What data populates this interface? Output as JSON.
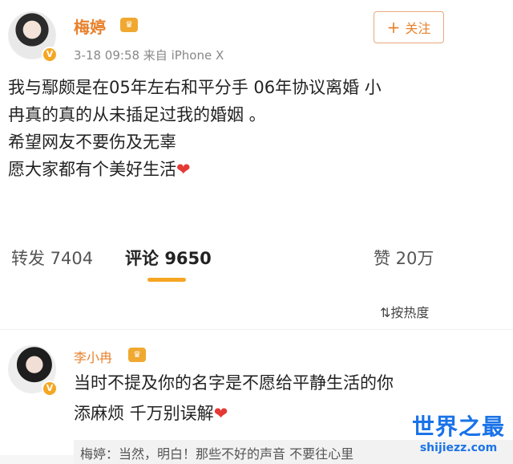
{
  "post": {
    "username": "梅婷",
    "meta": "3-18 09:58 来自 iPhone X",
    "follow_label": "关注",
    "lines": [
      "我与鄢颇是在05年左右和平分手  06年协议离婚 小",
      "冉真的真的从未插足过我的婚姻 。",
      "希望网友不要伤及无辜",
      "愿大家都有个美好生活"
    ]
  },
  "stats": {
    "repost": "转发 7404",
    "comment_label": "评论",
    "comment_count": "9650",
    "like": "赞 20万"
  },
  "sort_label": "按热度",
  "comment": {
    "username": "李小冉",
    "lines": [
      "当时不提及你的名字是不愿给平静生活的你",
      "添麻烦 千万别误解"
    ],
    "reply_preview": "梅婷：当然，明白！那些不好的声音 不要往心里"
  },
  "watermark": {
    "main": "世界之最",
    "sub": "shijiezz.com"
  },
  "colors": {
    "accent": "#e8812c",
    "brand": "#f5a623",
    "watermark": "#1a73e8"
  }
}
